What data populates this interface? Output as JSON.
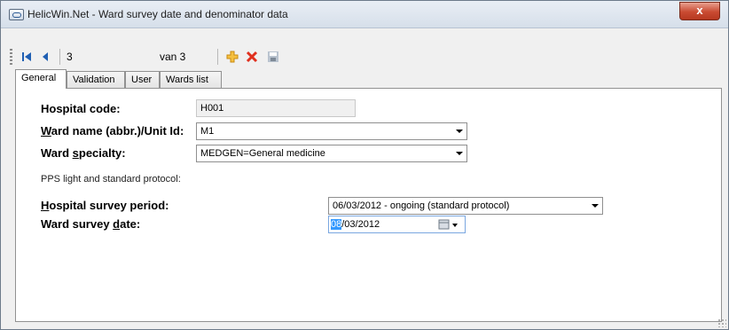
{
  "window": {
    "title": "HelicWin.Net - Ward survey date and denominator data",
    "close_label": "x"
  },
  "toolbar": {
    "first_icon": "first-record-icon",
    "prev_icon": "previous-record-icon",
    "position": "3",
    "count_label": "van 3",
    "add_icon": "add-icon",
    "delete_icon": "delete-icon",
    "save_icon": "save-icon"
  },
  "tabs": [
    {
      "label": "General",
      "active": true
    },
    {
      "label": "Validation",
      "active": false
    },
    {
      "label": "User",
      "active": false
    },
    {
      "label": "Wards list",
      "active": false
    }
  ],
  "form": {
    "hospital_code": {
      "label": "Hospital code:",
      "value": "H001"
    },
    "ward_name": {
      "label_accel": "W",
      "label_rest": "ard name (abbr.)/Unit Id:",
      "value": "M1"
    },
    "ward_specialty": {
      "label_pre": "Ward ",
      "label_accel": "s",
      "label_rest": "pecialty:",
      "value": "MEDGEN=General medicine"
    },
    "pps_note": "PPS light and standard protocol:",
    "survey_period": {
      "label_accel": "H",
      "label_rest": "ospital survey period:",
      "value": "06/03/2012 - ongoing (standard protocol)"
    },
    "survey_date": {
      "label_pre": "Ward survey ",
      "label_accel": "d",
      "label_rest": "ate:",
      "value_selected": "08",
      "value_rest": "/03/2012"
    }
  },
  "colors": {
    "accent": "#3399ff",
    "close": "#c94b32",
    "nav": "#1f5fb3"
  }
}
